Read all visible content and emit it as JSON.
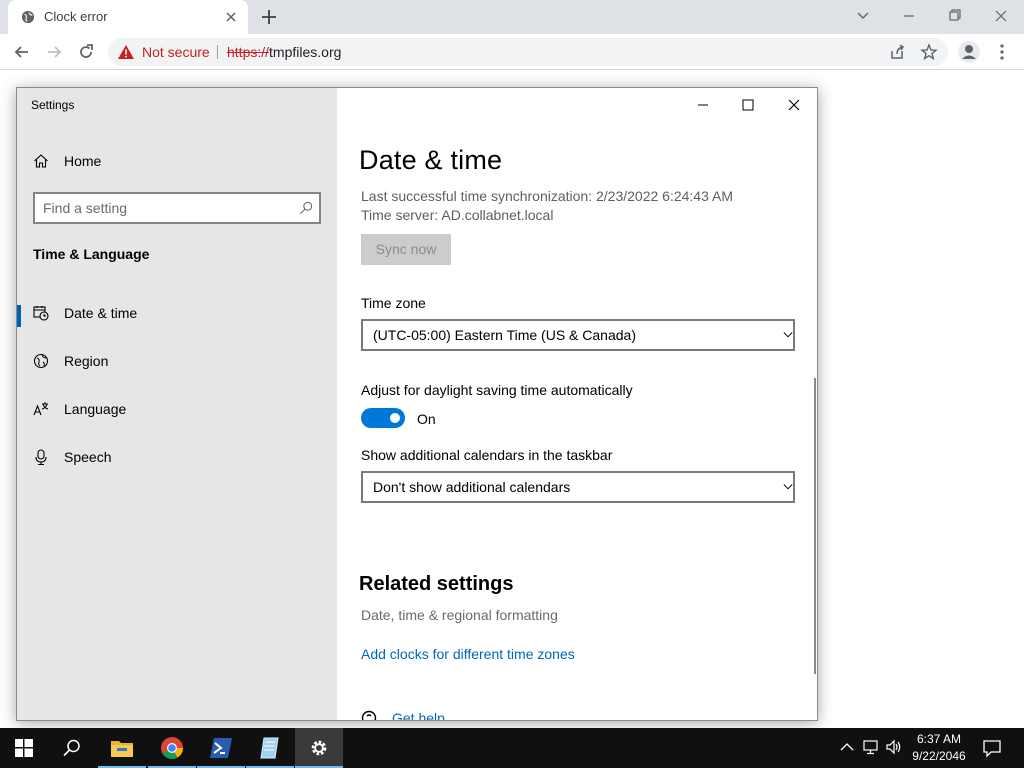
{
  "browser": {
    "tab_title": "Clock error",
    "security_label": "Not secure",
    "url_scheme": "https://",
    "url_host": "tmpfiles.org"
  },
  "settings": {
    "window_title": "Settings",
    "home_label": "Home",
    "search_placeholder": "Find a setting",
    "group_title": "Time & Language",
    "nav_items": [
      {
        "label": "Date & time",
        "icon": "calendar-clock-icon",
        "selected": true
      },
      {
        "label": "Region",
        "icon": "globe-icon",
        "selected": false
      },
      {
        "label": "Language",
        "icon": "language-icon",
        "selected": false
      },
      {
        "label": "Speech",
        "icon": "microphone-icon",
        "selected": false
      }
    ],
    "page_title": "Date & time",
    "last_sync": "Last successful time synchronization: 2/23/2022 6:24:43 AM",
    "time_server": "Time server: AD.collabnet.local",
    "sync_button": "Sync now",
    "timezone_label": "Time zone",
    "timezone_value": "(UTC-05:00) Eastern Time (US & Canada)",
    "dst_label": "Adjust for daylight saving time automatically",
    "dst_toggle_state": "On",
    "dst_enabled": true,
    "calendars_label": "Show additional calendars in the taskbar",
    "calendars_value": "Don't show additional calendars",
    "related_title": "Related settings",
    "related_subtext": "Date, time & regional formatting",
    "related_link": "Add clocks for different time zones",
    "get_help": "Get help"
  },
  "taskbar": {
    "apps": [
      "windows-start-icon",
      "search-icon",
      "file-explorer-icon",
      "chrome-icon",
      "powershell-icon",
      "notepad-icon",
      "settings-icon"
    ],
    "active_app": "settings-icon",
    "time": "6:37 AM",
    "date": "9/22/2046"
  },
  "colors": {
    "accent": "#0078d7",
    "link": "#0067b8",
    "warning": "#c5221f",
    "sidebar_bg": "#e6e6e6",
    "taskbar_bg": "#101010"
  }
}
